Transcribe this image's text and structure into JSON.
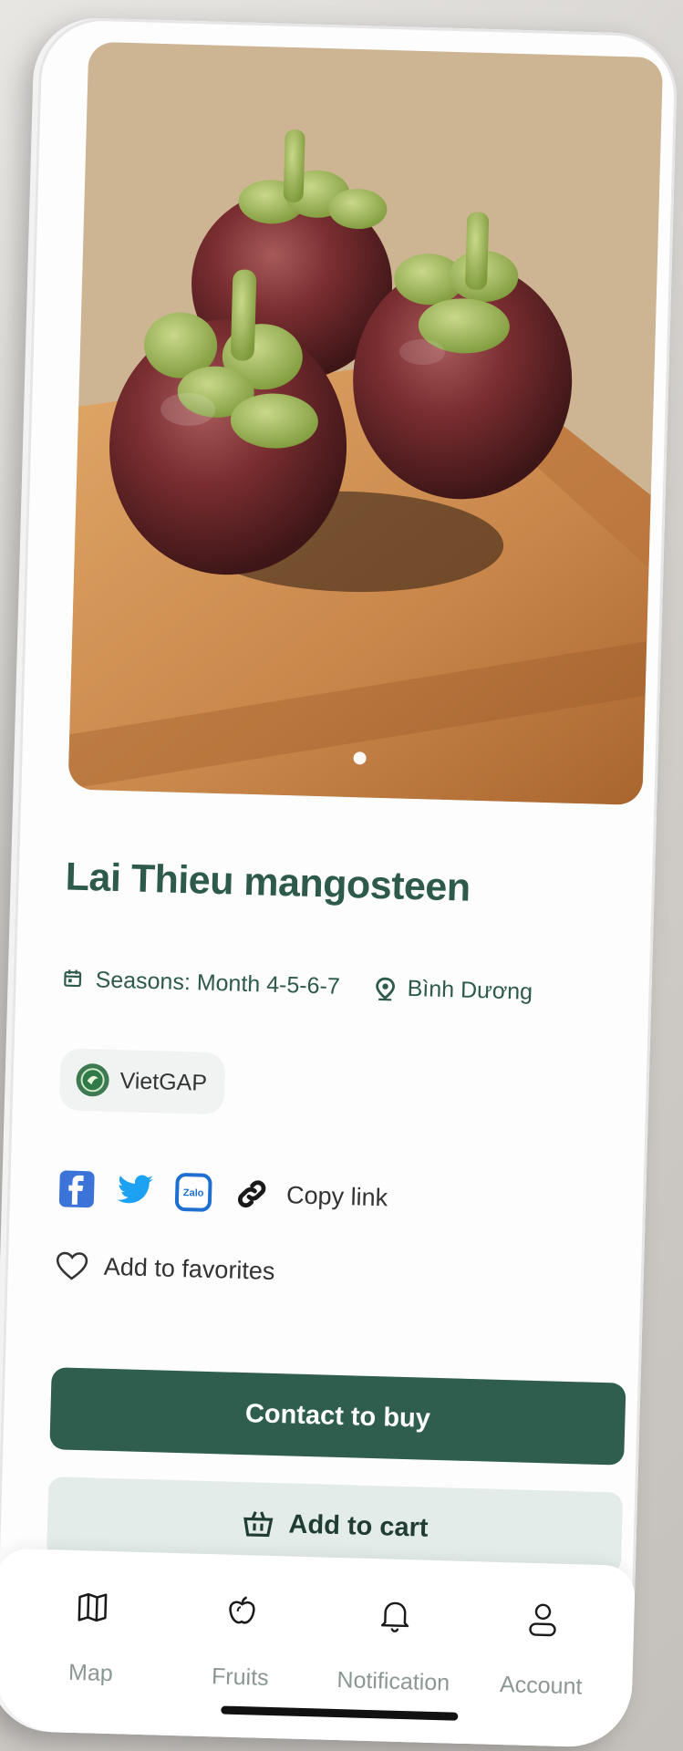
{
  "product": {
    "title": "Lai Thieu mangosteen",
    "seasons": "Seasons: Month 4-5-6-7",
    "location": "Bình Dương",
    "certification": "VietGAP"
  },
  "share": {
    "copy_link": "Copy link",
    "zalo_label": "Zalo"
  },
  "favorites": {
    "label": "Add to favorites"
  },
  "actions": {
    "contact": "Contact to buy",
    "add_to_cart": "Add to cart"
  },
  "tabbar": {
    "items": [
      {
        "label": "Map",
        "icon": "map-icon"
      },
      {
        "label": "Fruits",
        "icon": "fruit-icon"
      },
      {
        "label": "Notification",
        "icon": "bell-icon"
      },
      {
        "label": "Account",
        "icon": "user-icon"
      }
    ]
  },
  "colors": {
    "primary": "#2f5e4e",
    "secondary_bg": "#e3ece8",
    "title": "#2d5a4b",
    "facebook": "#3b73d8",
    "twitter": "#1da1f2"
  },
  "carousel": {
    "slide_count": 1,
    "active_index": 1
  }
}
